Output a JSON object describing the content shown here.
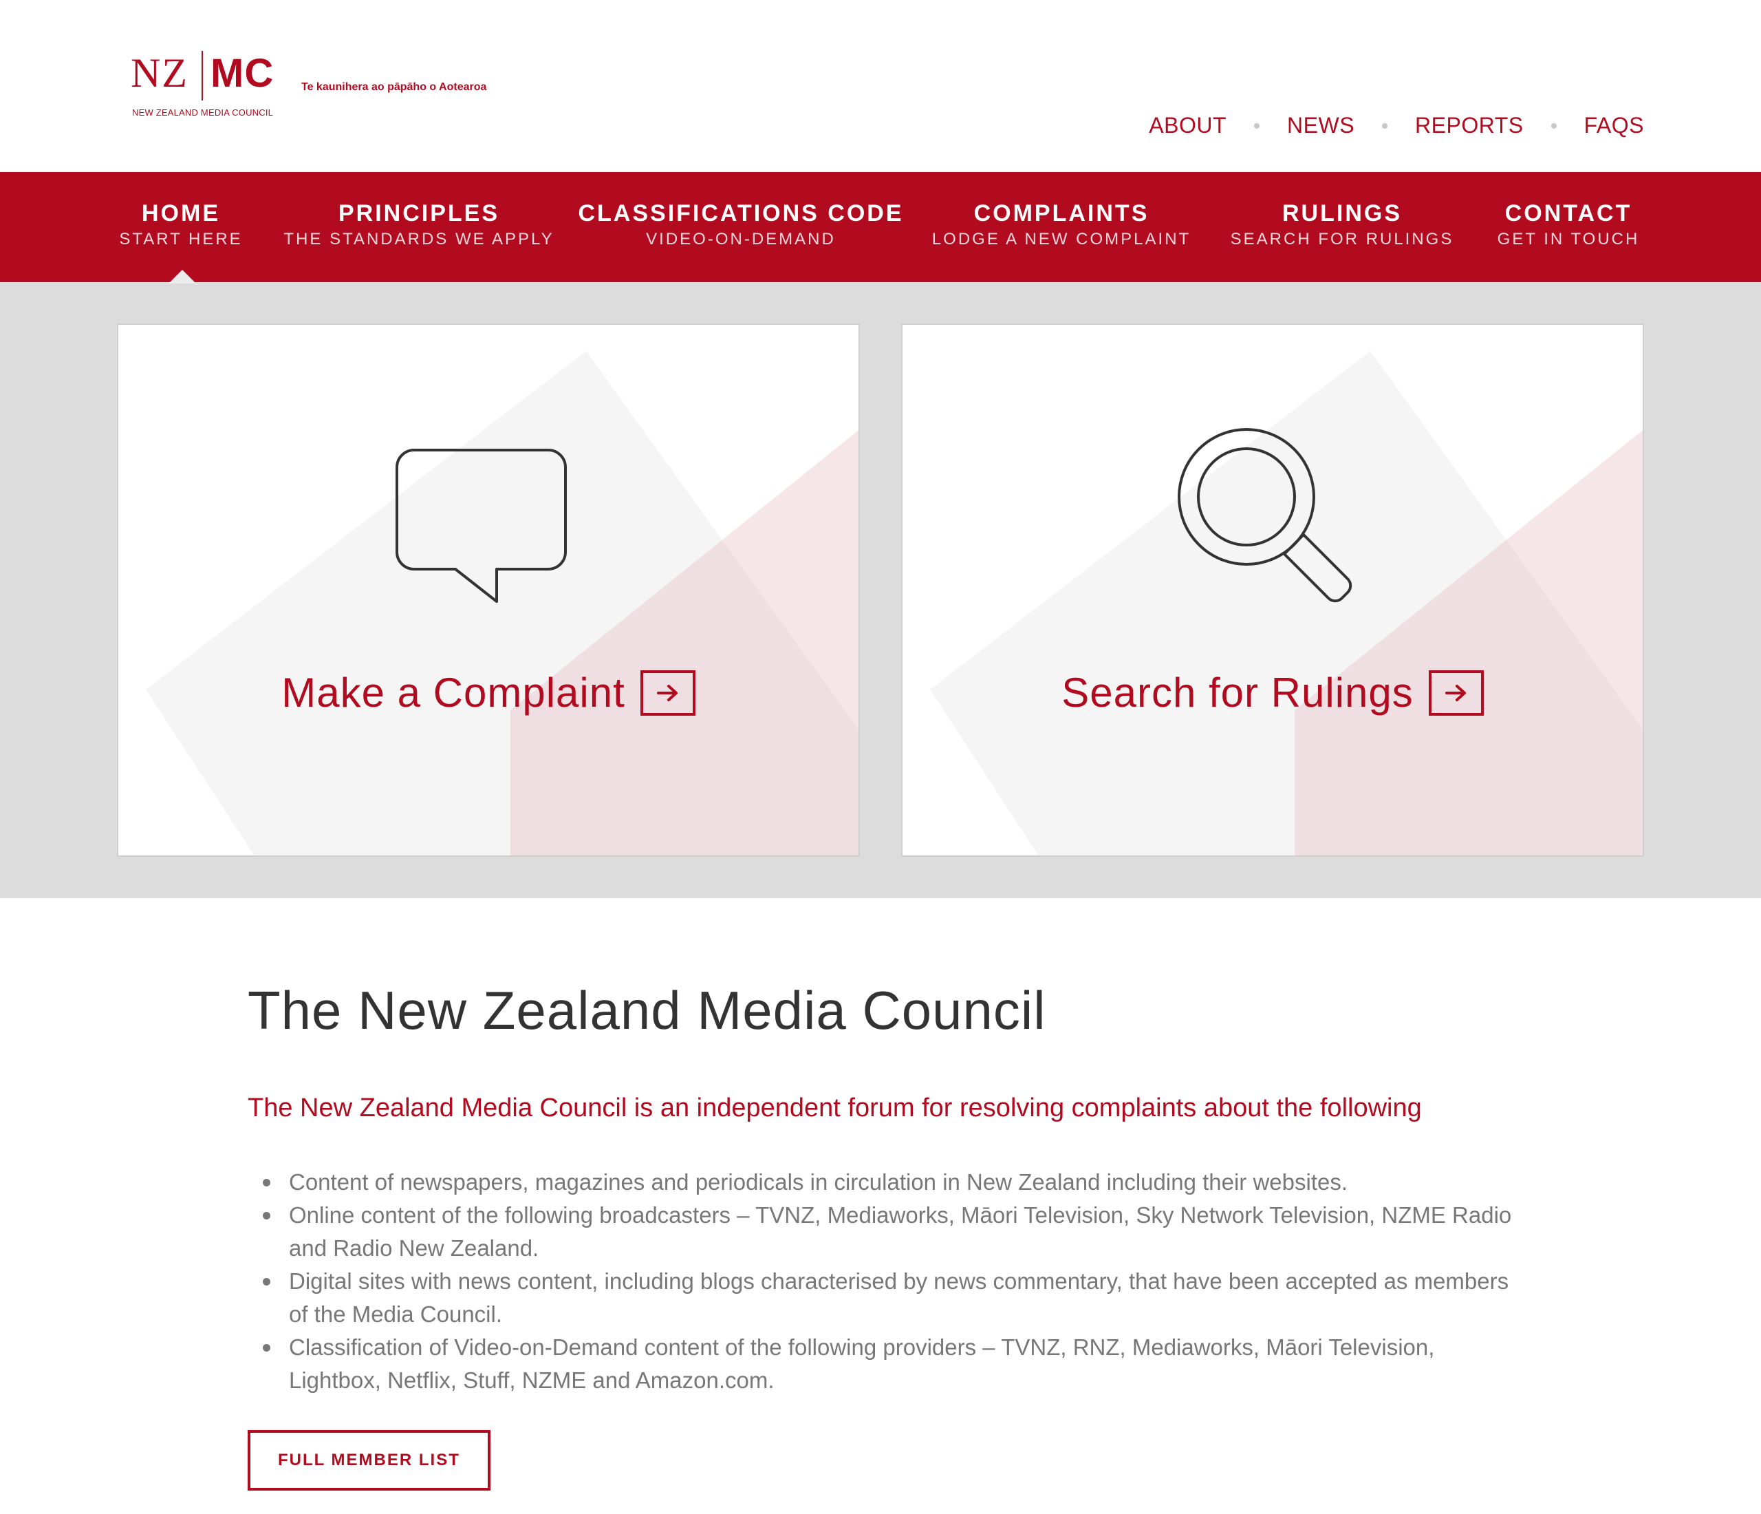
{
  "brand": {
    "logo_left": "NZ",
    "logo_right": "MC",
    "logo_sub": "NEW ZEALAND MEDIA COUNCIL",
    "tagline": "Te kaunihera ao pāpāho o Aotearoa",
    "color": "#b20a1f"
  },
  "topnav": {
    "items": [
      "ABOUT",
      "NEWS",
      "REPORTS",
      "FAQS"
    ]
  },
  "mainnav": {
    "items": [
      {
        "title": "HOME",
        "sub": "START HERE"
      },
      {
        "title": "PRINCIPLES",
        "sub": "THE STANDARDS WE APPLY"
      },
      {
        "title": "CLASSIFICATIONS CODE",
        "sub": "VIDEO-ON-DEMAND"
      },
      {
        "title": "COMPLAINTS",
        "sub": "LODGE A NEW COMPLAINT"
      },
      {
        "title": "RULINGS",
        "sub": "SEARCH FOR RULINGS"
      },
      {
        "title": "CONTACT",
        "sub": "GET IN TOUCH"
      }
    ],
    "active": "HOME"
  },
  "cards": [
    {
      "label": "Make a Complaint",
      "icon": "speech-bubble-icon"
    },
    {
      "label": "Search for Rulings",
      "icon": "magnifier-icon"
    }
  ],
  "content": {
    "heading": "The New Zealand Media Council",
    "lead": "The New Zealand Media Council is an independent forum for resolving complaints about the following",
    "bullets": [
      "Content of newspapers, magazines and periodicals in circulation in New Zealand including their websites.",
      "Online content of the following broadcasters – TVNZ, Mediaworks, Māori Television, Sky Network Television, NZME Radio and Radio New Zealand.",
      "Digital sites with news content, including blogs characterised by news commentary, that have been accepted as members of the Media Council.",
      "Classification of Video-on-Demand content of the following providers – TVNZ, RNZ, Mediaworks, Māori Television, Lightbox, Netflix, Stuff, NZME and Amazon.com."
    ],
    "button": "FULL MEMBER LIST"
  }
}
